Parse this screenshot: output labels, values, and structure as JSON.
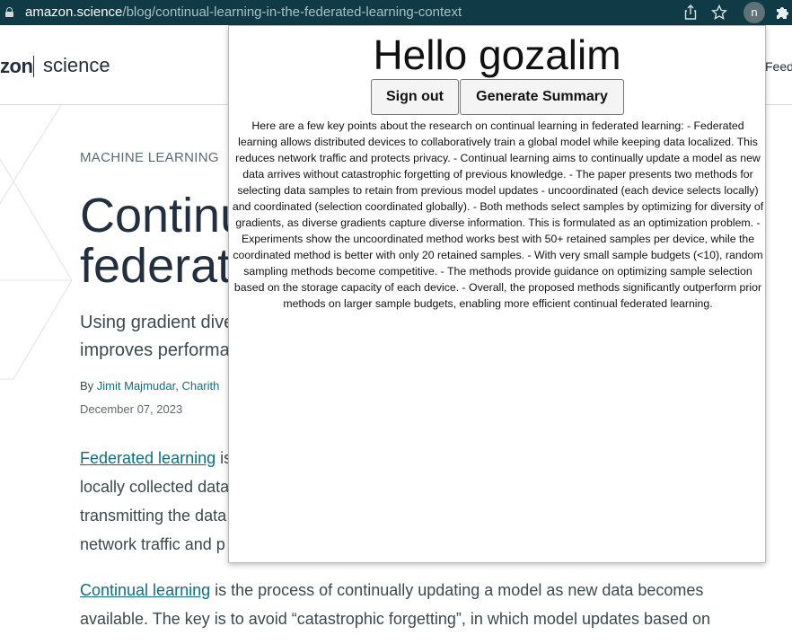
{
  "browser": {
    "url_domain": "amazon.science",
    "url_path": "/blog/continual-learning-in-the-federated-learning-context",
    "icons": [
      "lock-icon",
      "share-icon",
      "star-icon",
      "avatar",
      "extensions-icon"
    ],
    "avatar_letter": "n"
  },
  "site": {
    "logo_bold": "zon",
    "logo_name": "science",
    "nav_partial": "Feed"
  },
  "article": {
    "category": "MACHINE LEARNING",
    "title_line1": "Continu",
    "title_line2": "federate",
    "subtitle_line1": "Using gradient dive",
    "subtitle_line2": "improves performa",
    "by": "By",
    "author1": "Jimit Majmudar",
    "author2": "Charith",
    "date": "December 07, 2023",
    "para1_link": "Federated learning",
    "para1_line1_rest": " is",
    "para1_line2": "locally collected data",
    "para1_line3": "transmitting the data",
    "para1_line4": "network traffic and p",
    "para2_link": "Continual learning",
    "para2_line1_rest": " is the process of continually updating a model as new data becomes",
    "para2_line2": "available. The key is to avoid “catastrophic forgetting”, in which model updates based on"
  },
  "popup": {
    "greeting": "Hello gozalim",
    "signout_label": "Sign out",
    "summary_label": "Generate Summary",
    "summary_text": "Here are a few key points about the research on continual learning in federated learning: - Federated learning allows distributed devices to collaboratively train a global model while keeping data localized. This reduces network traffic and protects privacy. - Continual learning aims to continually update a model as new data arrives without catastrophic forgetting of previous knowledge. - The paper presents two methods for selecting data samples to retain from previous model updates - uncoordinated (each device selects locally) and coordinated (selection coordinated globally). - Both methods select samples by optimizing for diversity of gradients, as diverse gradients capture diverse information. This is formulated as an optimization problem. - Experiments show the uncoordinated method works best with 50+ retained samples per device, while the coordinated method is better with only 20 retained samples. - With very small sample budgets (<10), random sampling methods become competitive. - The methods provide guidance on optimizing sample selection based on the storage capacity of each device. - Overall, the proposed methods significantly outperform prior methods on larger sample budgets, enabling more efficient continual federated learning."
  }
}
